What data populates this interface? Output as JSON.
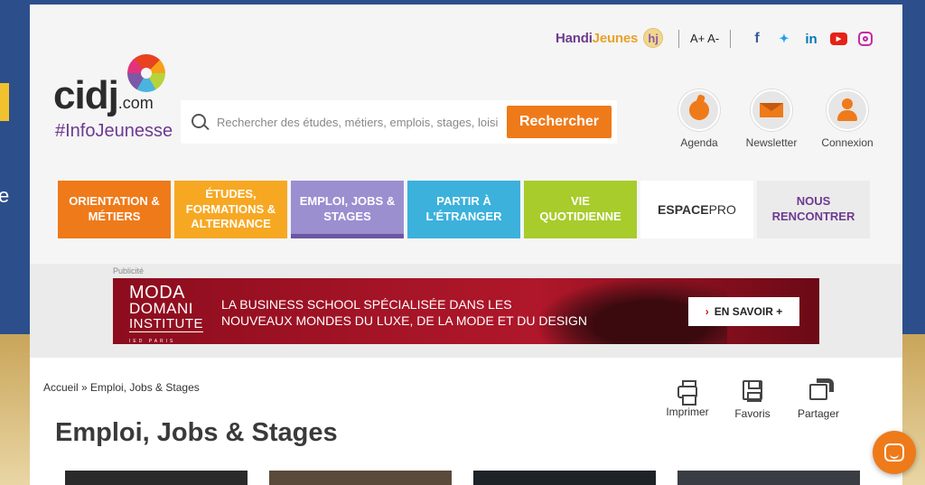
{
  "top_bar": {
    "handi_part1": "Handi",
    "handi_part2": "Jeunes",
    "handi_badge": "hj",
    "font_size_label": "A+ A-",
    "socials": [
      "facebook-icon",
      "twitter-icon",
      "linkedin-icon",
      "youtube-icon",
      "instagram-icon"
    ]
  },
  "logo": {
    "main": "cidj",
    "domain": ".com",
    "tagline": "#InfoJeunesse"
  },
  "search": {
    "placeholder": "Rechercher des études, métiers, emplois, stages, loisirs",
    "button_label": "Rechercher"
  },
  "quick_actions": [
    {
      "label": "Agenda"
    },
    {
      "label": "Newsletter"
    },
    {
      "label": "Connexion"
    }
  ],
  "nav": [
    {
      "label": "ORIENTATION & MÉTIERS",
      "color": "#ef7a1a"
    },
    {
      "label": "ÉTUDES, FORMATIONS & ALTERNANCE",
      "color": "#f7a823"
    },
    {
      "label": "EMPLOI, JOBS & STAGES",
      "color": "#9b8fd0"
    },
    {
      "label": "PARTIR À L'ÉTRANGER",
      "color": "#3bb1dc"
    },
    {
      "label": "VIE QUOTIDIENNE",
      "color": "#a7cc2b"
    },
    {
      "label_bold": "ESPACE",
      "label_rest": " PRO"
    },
    {
      "label": "NOUS RENCONTRER"
    }
  ],
  "ad": {
    "label": "Publicité",
    "brand_line1": "MODA",
    "brand_line2": "DOMANI",
    "brand_line3": "INSTITUTE",
    "brand_tiny": "IED PARIS",
    "text_line1": "LA BUSINESS SCHOOL SPÉCIALISÉE DANS LES",
    "text_line2": "NOUVEAUX MONDES DU LUXE, DE LA MODE ET DU DESIGN",
    "cta_label": "EN SAVOIR +",
    "cta_chevron": "›"
  },
  "breadcrumb": "Accueil » Emploi, Jobs & Stages",
  "page_title": "Emploi, Jobs & Stages",
  "tools": [
    {
      "label": "Imprimer"
    },
    {
      "label": "Favoris"
    },
    {
      "label": "Partager"
    }
  ],
  "colors": {
    "accent": "#ef7a1a",
    "purple": "#6e3a90"
  }
}
